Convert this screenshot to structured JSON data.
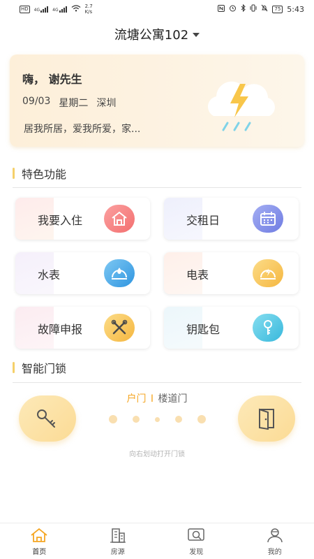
{
  "status_bar": {
    "carrier_badge": "HD",
    "network_1": "4G",
    "network_2": "4G",
    "speed_value": "2.7",
    "speed_unit": "K/s",
    "battery": "75",
    "time": "5:43"
  },
  "header": {
    "title": "流塘公寓102"
  },
  "welcome": {
    "greeting": "嗨， 谢先生",
    "date": "09/03",
    "weekday": "星期二",
    "city": "深圳",
    "motto": "居我所居，爱我所爱，家...",
    "weather_icon": "thunderstorm-cloud-icon"
  },
  "features_section": {
    "title": "特色功能",
    "items": [
      {
        "label": "我要入住",
        "icon": "house-icon",
        "color": "#f47b7b"
      },
      {
        "label": "交租日",
        "icon": "calendar-icon",
        "color": "#7b86e8"
      },
      {
        "label": "水表",
        "icon": "water-meter-icon",
        "color": "#3ca0e8"
      },
      {
        "label": "电表",
        "icon": "electric-meter-icon",
        "color": "#f7c14a"
      },
      {
        "label": "故障申报",
        "icon": "tools-icon",
        "color": "#f7c14a"
      },
      {
        "label": "钥匙包",
        "icon": "key-icon",
        "color": "#4cc4e0"
      }
    ]
  },
  "lock_section": {
    "title": "智能门锁",
    "tab_front": "户门",
    "tab_separator": "I",
    "tab_corridor": "楼道门",
    "hint": "向右划动打开门锁",
    "left_icon": "key-icon",
    "right_icon": "open-door-icon"
  },
  "bottom_nav": {
    "items": [
      {
        "label": "首页",
        "icon": "home-icon",
        "active": true
      },
      {
        "label": "房源",
        "icon": "building-icon",
        "active": false
      },
      {
        "label": "发现",
        "icon": "discover-icon",
        "active": false
      },
      {
        "label": "我的",
        "icon": "profile-icon",
        "active": false
      }
    ]
  },
  "colors": {
    "accent": "#f5a623",
    "card_bg": "#fdefd9",
    "section_bar": "#f5d06a"
  }
}
